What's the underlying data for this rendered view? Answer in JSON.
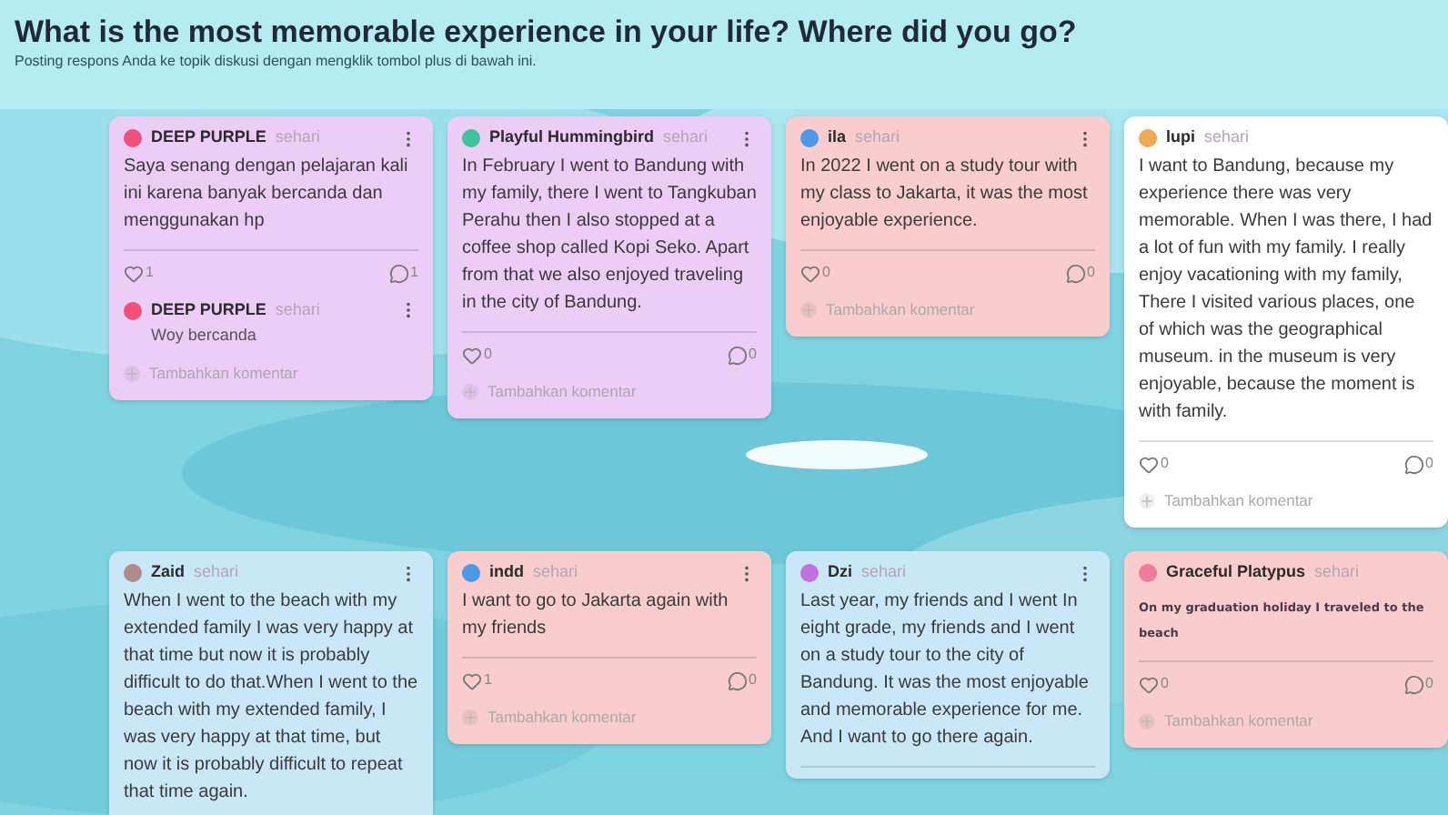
{
  "title": "What is the most memorable experience in your life? Where did you go?",
  "subtitle": "Posting respons Anda ke topik diskusi dengan mengklik tombol plus di bawah ini.",
  "rows": [
    [
      {
        "author": "DEEP PURPLE",
        "time": "sehari",
        "color": "#ebcdf6",
        "avatar": {
          "color": "#f0507a"
        },
        "kind": "normal",
        "menu": true,
        "text": "Saya senang dengan pelajaran kali ini karena banyak bercanda dan menggunakan hp",
        "likes": "1",
        "comments": "1",
        "replies": [
          {
            "author": "DEEP PURPLE",
            "time": "sehari",
            "avatar": {
              "color": "#f0507a"
            },
            "text": "Woy bercanda"
          }
        ],
        "add_comment": "Tambahkan komentar"
      },
      {
        "author": "Playful Hummingbird",
        "time": "sehari",
        "color": "#ebcdf6",
        "avatar": {
          "color": "#3cc49a"
        },
        "kind": "normal",
        "menu": true,
        "text": "In February I went to Bandung with my family, there I went to Tangkuban Perahu then I also stopped at a coffee shop called Kopi Seko. Apart from that we also enjoyed traveling in the city of Bandung.",
        "likes": "0",
        "comments": "0",
        "add_comment": "Tambahkan komentar"
      },
      {
        "author": "ila",
        "time": "sehari",
        "color": "#f9cdcd",
        "avatar": {
          "color": "#4a9ae8"
        },
        "kind": "normal",
        "menu": true,
        "text": "In 2022 I went on a study tour with my class to Jakarta, it was the most enjoyable experience.",
        "likes": "0",
        "comments": "0",
        "add_comment": "Tambahkan komentar"
      },
      {
        "author": "lupi",
        "time": "sehari",
        "color": "#ffffff",
        "avatar": {
          "color": "#f4a650"
        },
        "kind": "normal",
        "menu": false,
        "text": "I want to Bandung, because my experience there was very memorable. When I was there, I had a lot of fun with my family. I really enjoy vacationing with my family, There I visited various places, one of which was the geographical museum. in the museum is very enjoyable, because the moment is with family.",
        "likes": "0",
        "comments": "0",
        "add_comment": "Tambahkan komentar"
      }
    ],
    [
      {
        "author": "Zaid",
        "time": "sehari",
        "color": "#c8e8f7",
        "avatar": {
          "color": "#b08a8a"
        },
        "kind": "normal",
        "menu": true,
        "text": "When I went to the beach with my extended family I was very happy at that time but now it is probably difficult to do that.When I went to the beach with my extended family, I was very happy at that time, but now it is probably difficult to repeat that time again."
      },
      {
        "author": "indd",
        "time": "sehari",
        "color": "#f9cdcd",
        "avatar": {
          "color": "#4a9ae8"
        },
        "kind": "normal",
        "menu": true,
        "text": "I want to go to Jakarta again with my friends",
        "likes": "1",
        "comments": "0",
        "add_comment": "Tambahkan komentar"
      },
      {
        "author": "Dzi",
        "time": "sehari",
        "color": "#c8e8f7",
        "avatar": {
          "color": "#c070e0"
        },
        "kind": "normal",
        "menu": true,
        "text": "Last year, my friends and I went In eight grade, my friends and I went on a study tour to the city of Bandung. It was the most enjoyable and memorable experience for me. And I want to go there again."
      },
      {
        "author": "Graceful Platypus",
        "time": "sehari",
        "color": "#f9cdcd",
        "avatar": {
          "color": "#f07aa0"
        },
        "kind": "small",
        "menu": false,
        "text": "On my graduation holiday I traveled to the beach",
        "likes": "0",
        "comments": "0",
        "add_comment": "Tambahkan komentar"
      }
    ]
  ]
}
